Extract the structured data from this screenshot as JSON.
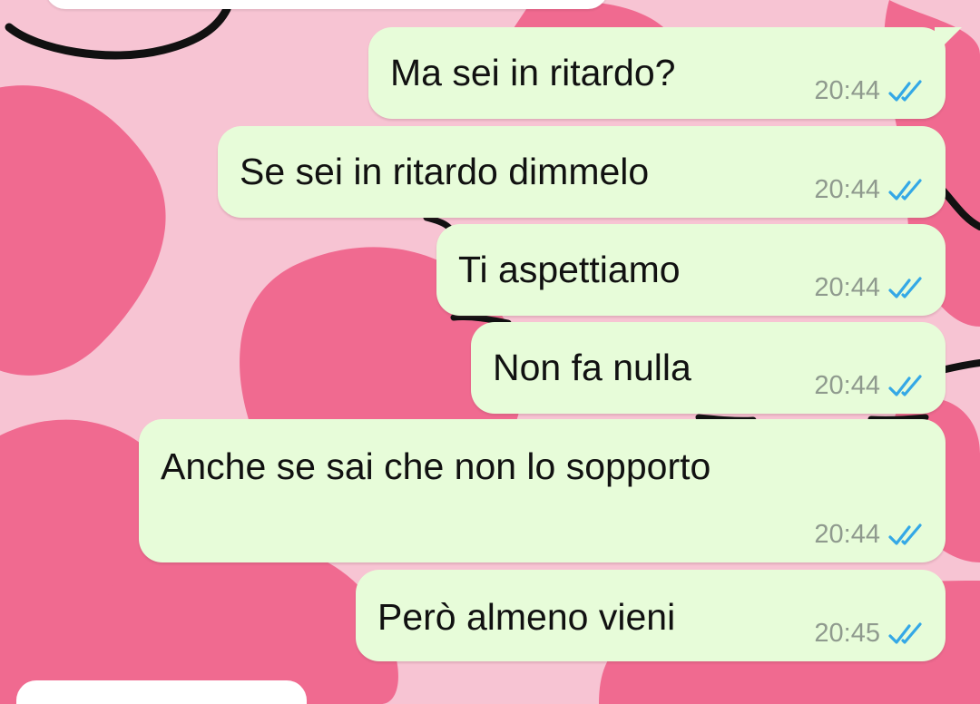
{
  "theme": {
    "bubble_color": "#e7fcd9",
    "read_tick_color": "#34a8e6",
    "wallpaper_base": "#f7c4d3",
    "wallpaper_blob": "#f06a90"
  },
  "messages": [
    {
      "text": "Ma sei in ritardo?",
      "time": "20:44",
      "status": "read"
    },
    {
      "text": "Se sei in ritardo dimmelo",
      "time": "20:44",
      "status": "read"
    },
    {
      "text": "Ti aspettiamo",
      "time": "20:44",
      "status": "read"
    },
    {
      "text": "Non fa nulla",
      "time": "20:44",
      "status": "read"
    },
    {
      "text": "Anche se sai che non lo sopporto",
      "time": "20:44",
      "status": "read"
    },
    {
      "text": "Però almeno vieni",
      "time": "20:45",
      "status": "read"
    }
  ],
  "icons": {
    "status_icon": "double-check-read-icon"
  }
}
